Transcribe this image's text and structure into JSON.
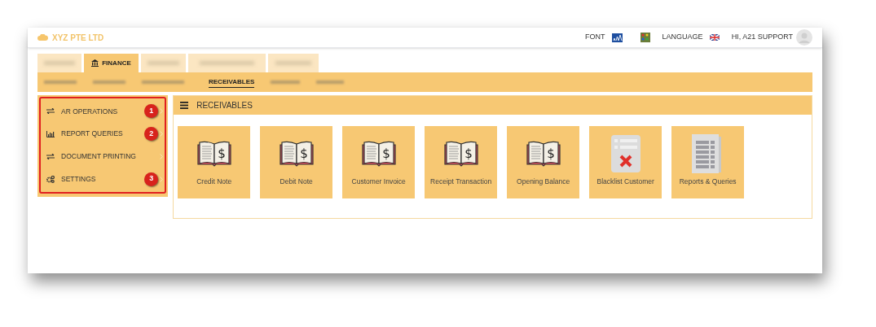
{
  "header": {
    "company": "XYZ PTE LTD",
    "font_label": "FONT",
    "language_label": "LANGUAGE",
    "greeting": "HI, A21 SUPPORT"
  },
  "tabs": [
    {
      "kind": "redacted",
      "selected": false
    },
    {
      "kind": "labelled",
      "label": "FINANCE",
      "selected": true
    },
    {
      "kind": "redacted",
      "selected": false
    },
    {
      "kind": "redacted",
      "selected": false
    },
    {
      "kind": "redacted",
      "selected": false
    }
  ],
  "subnav": [
    {
      "kind": "redacted",
      "selected": false
    },
    {
      "kind": "redacted",
      "selected": false
    },
    {
      "kind": "redacted",
      "selected": false
    },
    {
      "kind": "labelled",
      "label": "RECEIVABLES",
      "selected": true
    },
    {
      "kind": "redacted",
      "selected": false
    },
    {
      "kind": "redacted",
      "selected": false
    }
  ],
  "sidebar": {
    "items": [
      {
        "kind": "transfer",
        "label": "AR OPERATIONS",
        "callout": "1"
      },
      {
        "kind": "chart",
        "label": "REPORT QUERIES",
        "callout": "2"
      },
      {
        "kind": "transfer",
        "label": "DOCUMENT PRINTING"
      },
      {
        "kind": "cogs",
        "label": "SETTINGS",
        "callout": "3"
      }
    ]
  },
  "panel": {
    "title": "RECEIVABLES",
    "tiles": [
      {
        "kind": "book",
        "symbol": "$",
        "label": "Credit Note"
      },
      {
        "kind": "book",
        "symbol": "$",
        "label": "Debit Note"
      },
      {
        "kind": "book",
        "symbol": "$",
        "label": "Customer Invoice"
      },
      {
        "kind": "book",
        "symbol": "$",
        "label": "Receipt Transaction"
      },
      {
        "kind": "book",
        "symbol": "$",
        "label": "Opening Balance"
      },
      {
        "kind": "blacklist",
        "label": "Blacklist Customer"
      },
      {
        "kind": "report",
        "label": "Reports & Queries"
      }
    ]
  }
}
